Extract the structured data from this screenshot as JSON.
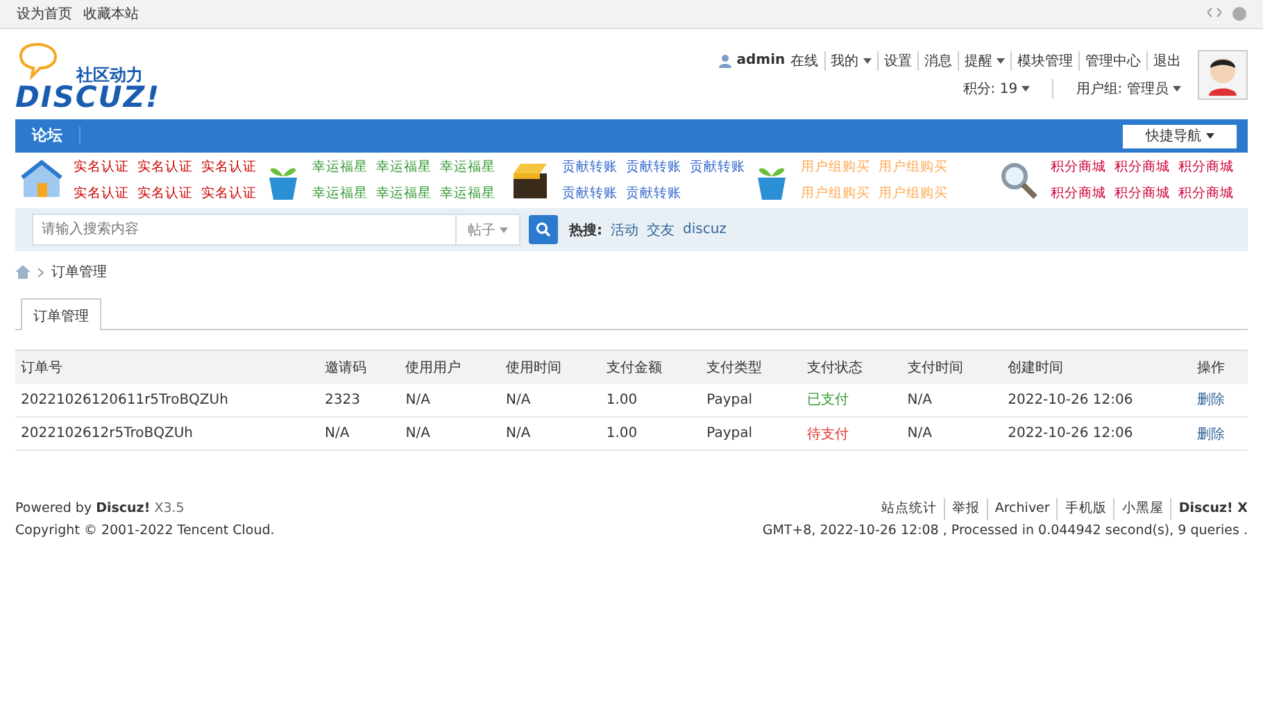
{
  "topbar": {
    "links": [
      "设为首页",
      "收藏本站"
    ]
  },
  "header": {
    "logo_tagline": "社区动力",
    "logo_text": "DISCUZ!",
    "user": {
      "name": "admin",
      "status": "在线",
      "links": [
        {
          "label": "我的",
          "dropdown": true
        },
        {
          "label": "设置",
          "dropdown": false
        },
        {
          "label": "消息",
          "dropdown": false
        },
        {
          "label": "提醒",
          "dropdown": true
        },
        {
          "label": "模块管理",
          "dropdown": false
        },
        {
          "label": "管理中心",
          "dropdown": false
        },
        {
          "label": "退出",
          "dropdown": false
        }
      ],
      "credits": "积分: 19",
      "group": "用户组: 管理员"
    }
  },
  "nav": {
    "items": [
      {
        "label": "论坛",
        "selected": true
      }
    ],
    "quick_nav": "快捷导航"
  },
  "ads": [
    {
      "kind": "house",
      "color": "#cc0000",
      "rows": [
        [
          "实名认证",
          "实名认证",
          "实名认证"
        ],
        [
          "实名认证",
          "实名认证",
          "实名认证"
        ]
      ]
    },
    {
      "kind": "plant",
      "color": "#339933",
      "rows": [
        [
          "幸运福星",
          "幸运福星",
          "幸运福星"
        ],
        [
          "幸运福星",
          "幸运福星",
          "幸运福星"
        ]
      ]
    },
    {
      "kind": "box",
      "color": "#3366cc",
      "rows": [
        [
          "贡献转账",
          "贡献转账",
          "贡献转账"
        ],
        [
          "贡献转账",
          "贡献转账"
        ]
      ]
    },
    {
      "kind": "plant",
      "color": "#ffaa55",
      "rows": [
        [
          "用户组购买",
          "用户组购买"
        ],
        [
          "用户组购买",
          "用户组购买"
        ]
      ]
    },
    {
      "kind": "search",
      "color": "#cc0033",
      "rows": [
        [
          "积分商城",
          "积分商城",
          "积分商城"
        ],
        [
          "积分商城",
          "积分商城",
          "积分商城"
        ]
      ]
    }
  ],
  "search": {
    "placeholder": "请输入搜索内容",
    "type": "帖子",
    "hot_label": "热搜:",
    "hot": [
      "活动",
      "交友",
      "discuz"
    ]
  },
  "breadcrumb": [
    "订单管理"
  ],
  "tabs": [
    {
      "label": "订单管理",
      "selected": true
    }
  ],
  "table": {
    "columns": [
      "订单号",
      "邀请码",
      "使用用户",
      "使用时间",
      "支付金额",
      "支付类型",
      "支付状态",
      "支付时间",
      "创建时间",
      "操作"
    ],
    "rows": [
      {
        "order": "20221026120611r5TroBQZUh",
        "code": "2323",
        "user": "N/A",
        "used": "N/A",
        "amount": "1.00",
        "type": "Paypal",
        "status": "已支付",
        "paid": true,
        "paid_time": "N/A",
        "created": "2022-10-26 12:06",
        "action": "删除"
      },
      {
        "order": "2022102612r5TroBQZUh",
        "code": "N/A",
        "user": "N/A",
        "used": "N/A",
        "amount": "1.00",
        "type": "Paypal",
        "status": "待支付",
        "paid": false,
        "paid_time": "N/A",
        "created": "2022-10-26 12:06",
        "action": "删除"
      }
    ]
  },
  "footer": {
    "powered_prefix": "Powered by",
    "powered_brand": "Discuz!",
    "version": "X3.5",
    "copyright": "Copyright © 2001-2022 Tencent Cloud.",
    "links": [
      "站点统计",
      "举报",
      "Archiver",
      "手机版",
      "小黑屋"
    ],
    "brand": "Discuz! X",
    "stats": "GMT+8, 2022-10-26 12:08 , Processed in 0.044942 second(s), 9 queries ."
  }
}
